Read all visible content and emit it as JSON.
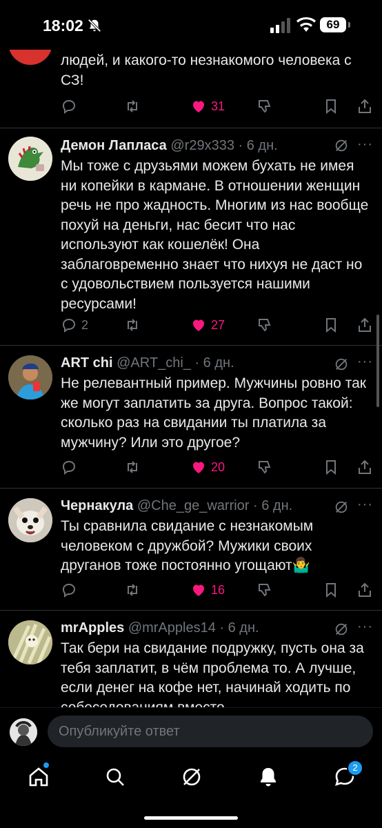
{
  "status_bar": {
    "time": "18:02",
    "battery": "69"
  },
  "tweets": [
    {
      "id": "t0",
      "text": "людей, и какого-то незнакомого человека с СЗ!",
      "likes": "31",
      "replies": ""
    },
    {
      "id": "t1",
      "name": "Демон Лапласа",
      "handle": "@r29x333",
      "time": "· 6 дн.",
      "text": "Мы тоже с друзьями можем бухать не имея ни копейки в кармане. В отношении женщин речь не про жадность. Многим из нас вообще похуй на деньги, нас бесит что нас используют как кошелёк! Она заблаговременно знает что нихуя не даст но с удовольствием пользуется нашими ресурсами!",
      "replies": "2",
      "likes": "27"
    },
    {
      "id": "t2",
      "name": "ART chi",
      "handle": "@ART_chi_",
      "time": "· 6 дн.",
      "text": "Не релевантный пример. Мужчины ровно так же могут заплатить за друга. Вопрос такой: сколько раз на свидании ты платила за мужчину? Или это другое?",
      "replies": "",
      "likes": "20"
    },
    {
      "id": "t3",
      "name": "Чернакула",
      "handle": "@Che_ge_warrior",
      "time": "· 6 дн.",
      "text": "Ты сравнила свидание с незнакомым человеком с дружбой? Мужики своих друганов тоже постоянно угощают🤷‍♂️",
      "replies": "",
      "likes": "16"
    },
    {
      "id": "t4",
      "name": "mrApples",
      "handle": "@mrApples14",
      "time": "· 6 дн.",
      "text": "Так бери на свидание подружку, пусть она за тебя заплатит, в чём проблема то. А лучше, если денег на кофе нет, начинай ходить по собеседованиям вместо",
      "replies": "",
      "likes": ""
    }
  ],
  "reply_bar": {
    "placeholder": "Опубликуйте ответ"
  },
  "tab_bar": {
    "notifications_badge": "2"
  },
  "colors": {
    "like": "#f91880",
    "accent": "#1d9bf0",
    "muted": "#71767b",
    "divider": "#2f3336"
  }
}
